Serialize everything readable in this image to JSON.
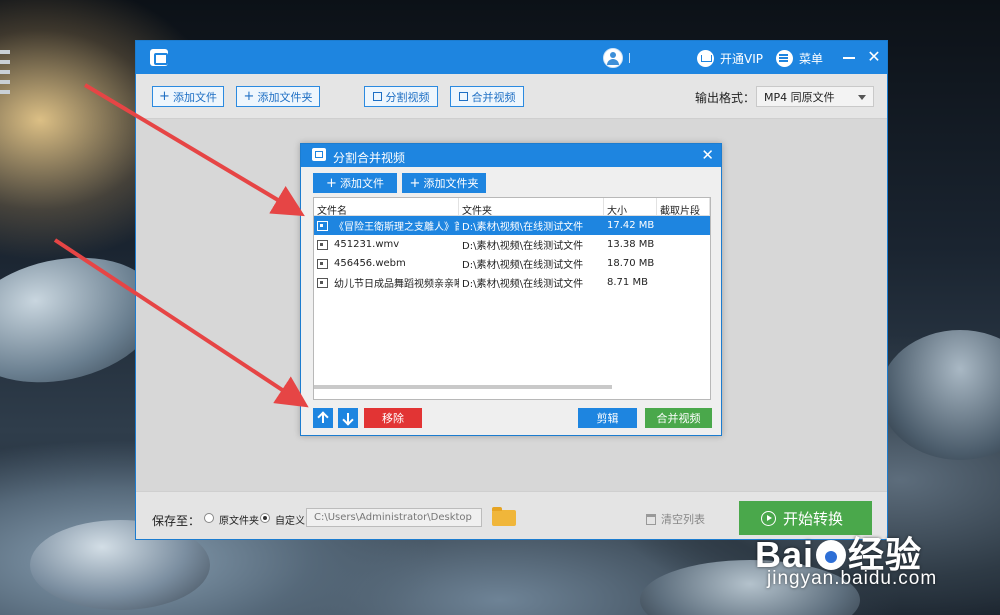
{
  "colors": {
    "primary": "#1e85e0",
    "success": "#4aa84b",
    "danger": "#e23434",
    "annotation": "#e64545"
  },
  "main_window": {
    "titlebar": {
      "vip_label": "开通VIP",
      "menu_label": "菜单",
      "close_glyph": "✕"
    },
    "toolbar": {
      "add_file_label": "添加文件",
      "add_folder_label": "添加文件夹",
      "split_label": "分割视频",
      "merge_label": "合并视频",
      "output_format_label": "输出格式：",
      "output_format_value": "MP4  同原文件"
    },
    "bottombar": {
      "save_to_label": "保存至：",
      "option_source_folder": "原文件夹",
      "option_custom": "自定义",
      "selected_option": "custom",
      "save_path": "C:\\Users\\Administrator\\Desktop",
      "clear_list_label": "清空列表",
      "start_label": "开始转换"
    }
  },
  "dialog": {
    "title": "分割合并视频",
    "close_glyph": "✕",
    "add_file_label": "添加文件",
    "add_folder_label": "添加文件夹",
    "table": {
      "columns": [
        "文件名",
        "文件夹",
        "大小",
        "截取片段"
      ],
      "rows": [
        {
          "name": "《冒险王衛斯理之支離人》首",
          "folder": "D:\\素材\\视频\\在线测试文件",
          "size": "17.42 MB",
          "segment": "",
          "selected": true
        },
        {
          "name": "451231.wmv",
          "folder": "D:\\素材\\视频\\在线测试文件",
          "size": "13.38 MB",
          "segment": "",
          "selected": false
        },
        {
          "name": "456456.webm",
          "folder": "D:\\素材\\视频\\在线测试文件",
          "size": "18.70 MB",
          "segment": "",
          "selected": false
        },
        {
          "name": "幼儿节日成品舞蹈视频亲亲嘟嘟",
          "folder": "D:\\素材\\视频\\在线测试文件",
          "size": "8.71 MB",
          "segment": "",
          "selected": false
        }
      ]
    },
    "remove_label": "移除",
    "edit_label": "剪辑",
    "merge_label": "合并视频"
  },
  "watermark": {
    "brand_prefix": "Bai",
    "brand_suffix": "经验",
    "url": "jingyan.baidu.com"
  }
}
